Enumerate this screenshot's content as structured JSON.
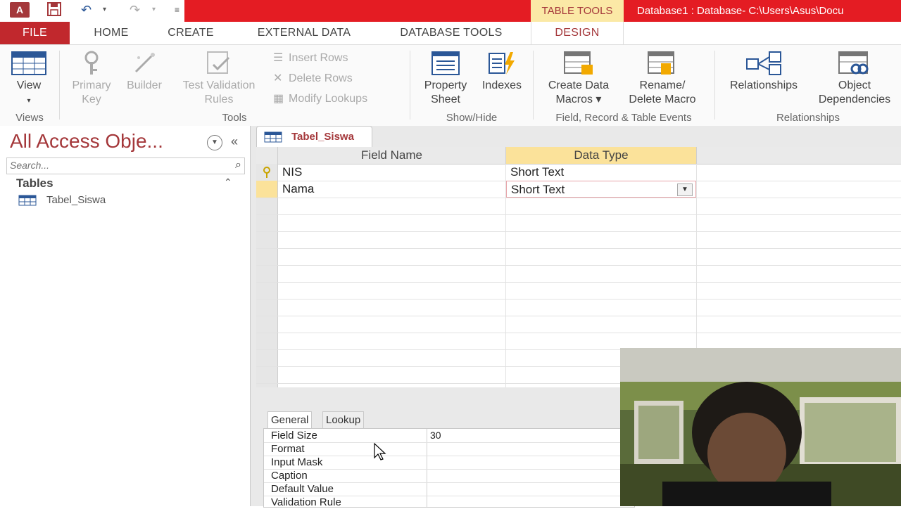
{
  "titlebar": {
    "app_icon_text": "A",
    "contextual_tab": "TABLE TOOLS",
    "window_title": "Database1 : Database- C:\\Users\\Asus\\Docu"
  },
  "tabs": [
    "FILE",
    "HOME",
    "CREATE",
    "EXTERNAL DATA",
    "DATABASE TOOLS",
    "DESIGN"
  ],
  "ribbon": {
    "views": {
      "view_label": "View",
      "group": "Views"
    },
    "tools": {
      "primary_key_1": "Primary",
      "primary_key_2": "Key",
      "builder": "Builder",
      "test_1": "Test Validation",
      "test_2": "Rules",
      "insert_rows": "Insert Rows",
      "delete_rows": "Delete Rows",
      "modify_lookups": "Modify Lookups",
      "group": "Tools"
    },
    "showhide": {
      "property_1": "Property",
      "property_2": "Sheet",
      "indexes": "Indexes",
      "group": "Show/Hide"
    },
    "events": {
      "create_1": "Create Data",
      "create_2": "Macros ▾",
      "rename_1": "Rename/",
      "rename_2": "Delete Macro",
      "group": "Field, Record & Table Events"
    },
    "relationships": {
      "relationships": "Relationships",
      "objdep_1": "Object",
      "objdep_2": "Dependencies",
      "group": "Relationships"
    }
  },
  "nav": {
    "title": "All Access Obje...",
    "search_placeholder": "Search...",
    "group": "Tables",
    "items": [
      "Tabel_Siswa"
    ]
  },
  "document": {
    "tab_label": "Tabel_Siswa",
    "columns": {
      "field_name": "Field Name",
      "data_type": "Data Type"
    },
    "rows": [
      {
        "field_name": "NIS",
        "data_type": "Short Text"
      },
      {
        "field_name": "Nama",
        "data_type": "Short Text"
      }
    ]
  },
  "properties": {
    "tabs": [
      "General",
      "Lookup"
    ],
    "rows": [
      {
        "label": "Field Size",
        "value": "30"
      },
      {
        "label": "Format",
        "value": ""
      },
      {
        "label": "Input Mask",
        "value": ""
      },
      {
        "label": "Caption",
        "value": ""
      },
      {
        "label": "Default Value",
        "value": ""
      },
      {
        "label": "Validation Rule",
        "value": ""
      }
    ]
  },
  "colors": {
    "titlebar_red": "#e41c23",
    "access_accent": "#a4373a",
    "contextual_yellow": "#fbe29a"
  }
}
